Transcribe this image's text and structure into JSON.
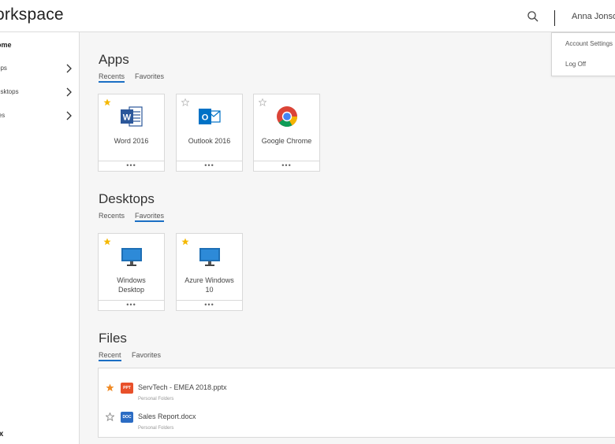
{
  "header": {
    "brand": "orkspace",
    "user_name": "Anna Jonso"
  },
  "sidebar": {
    "items": [
      {
        "label": "ome"
      },
      {
        "label": "pps"
      },
      {
        "label": "esktops"
      },
      {
        "label": "les"
      }
    ],
    "footer_logo": "ix"
  },
  "user_menu": {
    "items": [
      {
        "label": "Account Settings"
      },
      {
        "label": "Log Off"
      }
    ]
  },
  "apps": {
    "title": "Apps",
    "tabs": [
      {
        "label": "Recents"
      },
      {
        "label": "Favorites"
      }
    ],
    "active_tab": "Recents",
    "tiles": [
      {
        "name": "Word 2016",
        "favorite": true,
        "icon": "word-icon",
        "more": "•••"
      },
      {
        "name": "Outlook 2016",
        "favorite": false,
        "icon": "outlook-icon",
        "more": "•••"
      },
      {
        "name": "Google Chrome",
        "favorite": false,
        "icon": "chrome-icon",
        "more": "•••"
      }
    ]
  },
  "desktops": {
    "title": "Desktops",
    "tabs": [
      {
        "label": "Recents"
      },
      {
        "label": "Favorites"
      }
    ],
    "active_tab": "Favorites",
    "tiles": [
      {
        "name_line1": "Windows",
        "name_line2": "Desktop",
        "favorite": true,
        "icon": "monitor-icon",
        "more": "•••"
      },
      {
        "name_line1": "Azure Windows",
        "name_line2": "10",
        "favorite": true,
        "icon": "monitor-icon",
        "more": "•••"
      }
    ]
  },
  "files": {
    "title": "Files",
    "tabs": [
      {
        "label": "Recent"
      },
      {
        "label": "Favorites"
      }
    ],
    "active_tab": "Recent",
    "items": [
      {
        "name": "ServTech - EMEA 2018.pptx",
        "location": "Personal Folders",
        "type": "PPT",
        "type_color": "#e8502a",
        "favorite": true
      },
      {
        "name": "Sales Report.docx",
        "location": "Personal Folders",
        "type": "DOC",
        "type_color": "#2b6cc4",
        "favorite": false
      }
    ]
  },
  "colors": {
    "accent": "#1b6fc4",
    "star_favorite": "#f5b800",
    "star_file": "#f08a24"
  }
}
